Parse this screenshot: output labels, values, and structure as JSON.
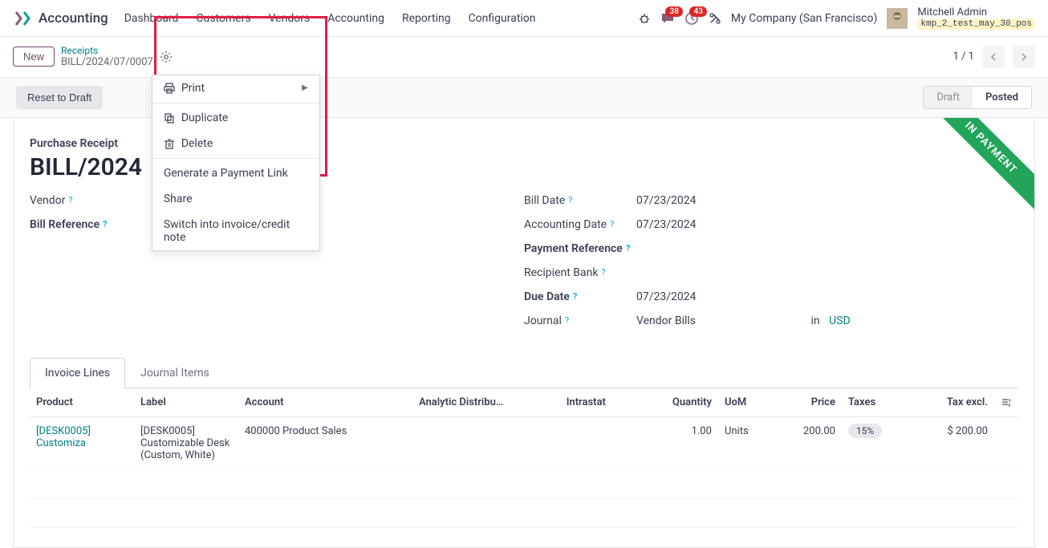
{
  "app_title": "Accounting",
  "nav": [
    "Dashboard",
    "Customers",
    "Vendors",
    "Accounting",
    "Reporting",
    "Configuration"
  ],
  "badges": {
    "messages": "38",
    "activities": "43"
  },
  "company": "My Company (San Francisco)",
  "user": {
    "name": "Mitchell Admin",
    "db": "kmp_2_test_may_30_pos"
  },
  "breadcrumb": {
    "new": "New",
    "parent": "Receipts",
    "current": "BILL/2024/07/0007"
  },
  "gear_menu": {
    "print": "Print",
    "duplicate": "Duplicate",
    "delete": "Delete",
    "payment_link": "Generate a Payment Link",
    "share": "Share",
    "switch": "Switch into invoice/credit note"
  },
  "pager": {
    "text": "1 / 1"
  },
  "actions": {
    "reset": "Reset to Draft"
  },
  "status": {
    "draft": "Draft",
    "posted": "Posted"
  },
  "ribbon": "IN PAYMENT",
  "sheet": {
    "subtitle": "Purchase Receipt",
    "title": "BILL/2024",
    "fields_left": {
      "vendor_label": "Vendor",
      "bill_ref_label": "Bill Reference"
    },
    "fields_right": {
      "bill_date_label": "Bill Date",
      "bill_date": "07/23/2024",
      "acc_date_label": "Accounting Date",
      "acc_date": "07/23/2024",
      "pay_ref_label": "Payment Reference",
      "recipient_bank_label": "Recipient Bank",
      "due_date_label": "Due Date",
      "due_date": "07/23/2024",
      "journal_label": "Journal",
      "journal": "Vendor Bills",
      "in": "in",
      "currency": "USD"
    }
  },
  "tabs": {
    "invoice_lines": "Invoice Lines",
    "journal_items": "Journal Items"
  },
  "table": {
    "headers": {
      "product": "Product",
      "label": "Label",
      "account": "Account",
      "analytic": "Analytic Distribu…",
      "intrastat": "Intrastat",
      "quantity": "Quantity",
      "uom": "UoM",
      "price": "Price",
      "taxes": "Taxes",
      "tax_excl": "Tax excl."
    },
    "row": {
      "product": "[DESK0005] Customiza",
      "label": "[DESK0005] Customizable Desk (Custom, White)",
      "account": "400000 Product Sales",
      "quantity": "1.00",
      "uom": "Units",
      "price": "200.00",
      "taxes": "15%",
      "tax_excl": "$ 200.00"
    }
  }
}
